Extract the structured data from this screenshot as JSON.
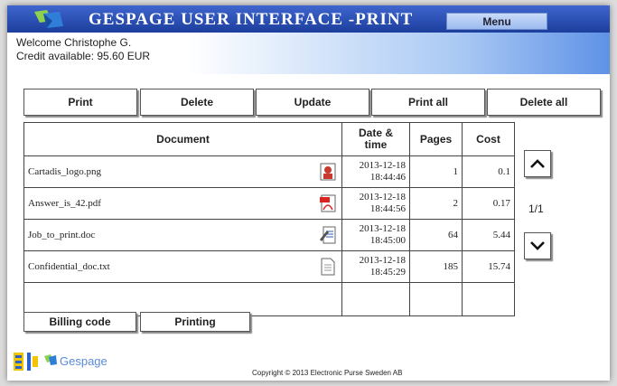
{
  "header": {
    "title": "GESPAGE USER INTERFACE -PRINT",
    "menu_label": "Menu",
    "welcome": "Welcome Christophe G.",
    "credit": "Credit available: 95.60 EUR"
  },
  "toolbar": {
    "print": "Print",
    "delete": "Delete",
    "update": "Update",
    "print_all": "Print all",
    "delete_all": "Delete all"
  },
  "table": {
    "headers": {
      "document": "Document",
      "datetime": "Date & time",
      "pages": "Pages",
      "cost": "Cost"
    },
    "rows": [
      {
        "name": "Cartadis_logo.png",
        "date": "2013-12-18",
        "time": "18:44:46",
        "pages": "1",
        "cost": "0.1",
        "icon": "image-file-icon"
      },
      {
        "name": "Answer_is_42.pdf",
        "date": "2013-12-18",
        "time": "18:44:56",
        "pages": "2",
        "cost": "0.17",
        "icon": "pdf-file-icon"
      },
      {
        "name": "Job_to_print.doc",
        "date": "2013-12-18",
        "time": "18:45:00",
        "pages": "64",
        "cost": "5.44",
        "icon": "doc-file-icon"
      },
      {
        "name": "Confidential_doc.txt",
        "date": "2013-12-18",
        "time": "18:45:29",
        "pages": "185",
        "cost": "15.74",
        "icon": "txt-file-icon"
      }
    ]
  },
  "pagination": {
    "indicator": "1/1"
  },
  "bottom_tabs": {
    "billing": "Billing code",
    "printing": "Printing"
  },
  "footer": {
    "brand": "Gespage",
    "copyright": "Copyright © 2013 Electronic Purse Sweden AB"
  },
  "colors": {
    "title_bar": "#1c3e9c",
    "accent": "#5f92e6"
  }
}
